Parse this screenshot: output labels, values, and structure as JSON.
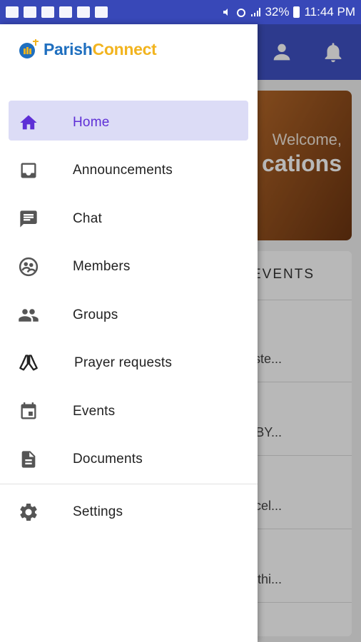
{
  "status_bar": {
    "battery": "32%",
    "time": "11:44 PM"
  },
  "background": {
    "welcome": "Welcome,",
    "name": "cations",
    "events_title": "EVENTS",
    "event_snippets": [
      "ste...",
      "BY...",
      "cel...",
      "thi..."
    ]
  },
  "drawer": {
    "logo": {
      "part1": "Parish",
      "part2": "Connect"
    },
    "items": [
      {
        "label": "Home",
        "icon": "home-icon"
      },
      {
        "label": "Announcements",
        "icon": "inbox-icon"
      },
      {
        "label": "Chat",
        "icon": "chat-icon"
      },
      {
        "label": "Members",
        "icon": "members-icon"
      },
      {
        "label": "Groups",
        "icon": "groups-icon"
      },
      {
        "label": "Prayer requests",
        "icon": "praying-hands-icon"
      },
      {
        "label": "Events",
        "icon": "calendar-icon"
      },
      {
        "label": "Documents",
        "icon": "document-icon"
      }
    ],
    "settings": {
      "label": "Settings",
      "icon": "gear-icon"
    }
  },
  "colors": {
    "primary": "#3f51c4",
    "status_bar": "#3848b8",
    "active_bg": "#dcdcf6",
    "active_text": "#5e2fd6",
    "logo_blue": "#1f6fbf",
    "logo_gold": "#f2b41f"
  }
}
